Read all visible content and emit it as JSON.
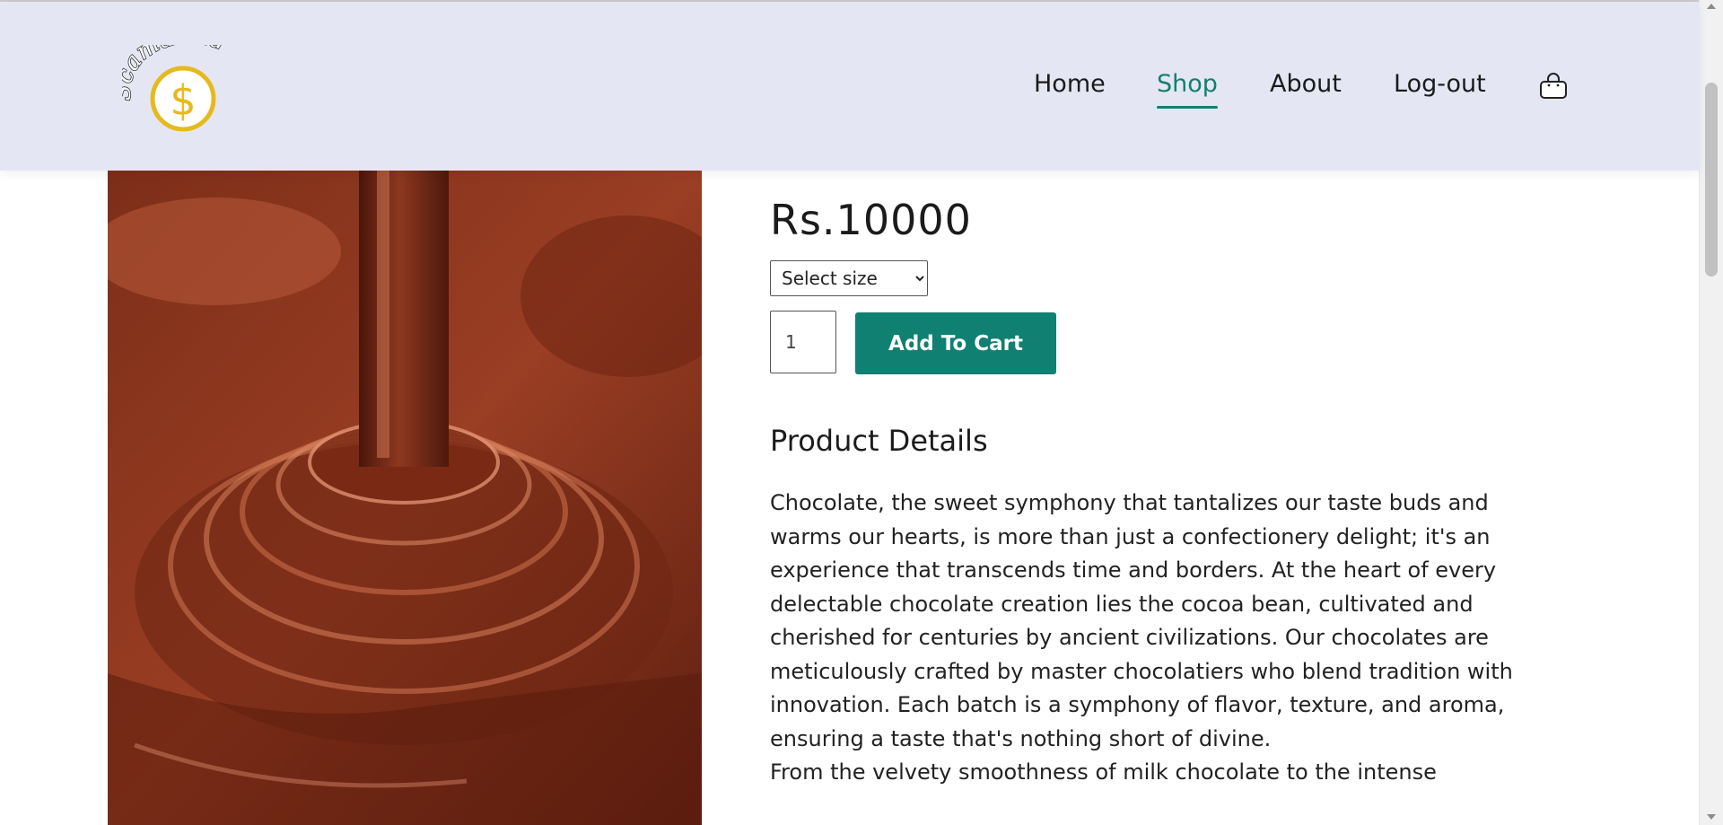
{
  "header": {
    "logo_text": "Scamazoid",
    "logo_symbol": "$",
    "nav": [
      {
        "label": "Home",
        "active": false
      },
      {
        "label": "Shop",
        "active": true
      },
      {
        "label": "About",
        "active": false
      },
      {
        "label": "Log-out",
        "active": false
      }
    ],
    "cart_icon": "shopping-bag-icon"
  },
  "product": {
    "price": "Rs.10000",
    "size_select": {
      "selected": "Select size"
    },
    "quantity": "1",
    "add_to_cart_label": "Add To Cart",
    "details_heading": "Product Details",
    "details_text": "Chocolate, the sweet symphony that tantalizes our taste buds and warms our hearts, is more than just a confectionery delight; it's an experience that transcends time and borders. At the heart of every delectable chocolate creation lies the cocoa bean, cultivated and cherished for centuries by ancient civilizations. Our chocolates are meticulously crafted by master chocolatiers who blend tradition with innovation. Each batch is a symphony of flavor, texture, and aroma, ensuring a taste that's nothing short of divine.\nFrom the velvety smoothness of milk chocolate to the intense"
  },
  "colors": {
    "header_bg": "#e4e7f3",
    "accent": "#11806f",
    "button_bg": "#0f8072",
    "logo_yellow": "#e6b91e"
  }
}
